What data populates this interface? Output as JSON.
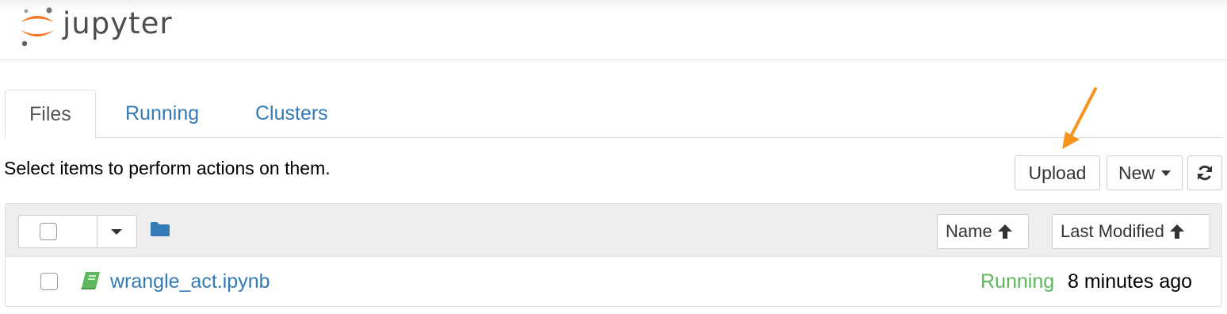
{
  "header": {
    "app_name": "jupyter",
    "logo_icon": "jupyter-logo-icon"
  },
  "tabs": [
    {
      "label": "Files",
      "active": true
    },
    {
      "label": "Running",
      "active": false
    },
    {
      "label": "Clusters",
      "active": false
    }
  ],
  "toolbar": {
    "instruction": "Select items to perform actions on them.",
    "upload_label": "Upload",
    "new_label": "New",
    "refresh_icon": "refresh-icon"
  },
  "list_header": {
    "select_all_checked": false,
    "folder_icon": "folder-icon",
    "sort_name_label": "Name",
    "sort_modified_label": "Last Modified",
    "sort_icon": "arrow-up-icon"
  },
  "files": [
    {
      "name": "wrangle_act.ipynb",
      "icon": "notebook-icon",
      "status": "Running",
      "modified": "8 minutes ago",
      "checked": false
    }
  ],
  "colors": {
    "link": "#337ab7",
    "running": "#5cb85c",
    "accent_arrow": "#f7941e",
    "jupyter_orange": "#f37726"
  }
}
